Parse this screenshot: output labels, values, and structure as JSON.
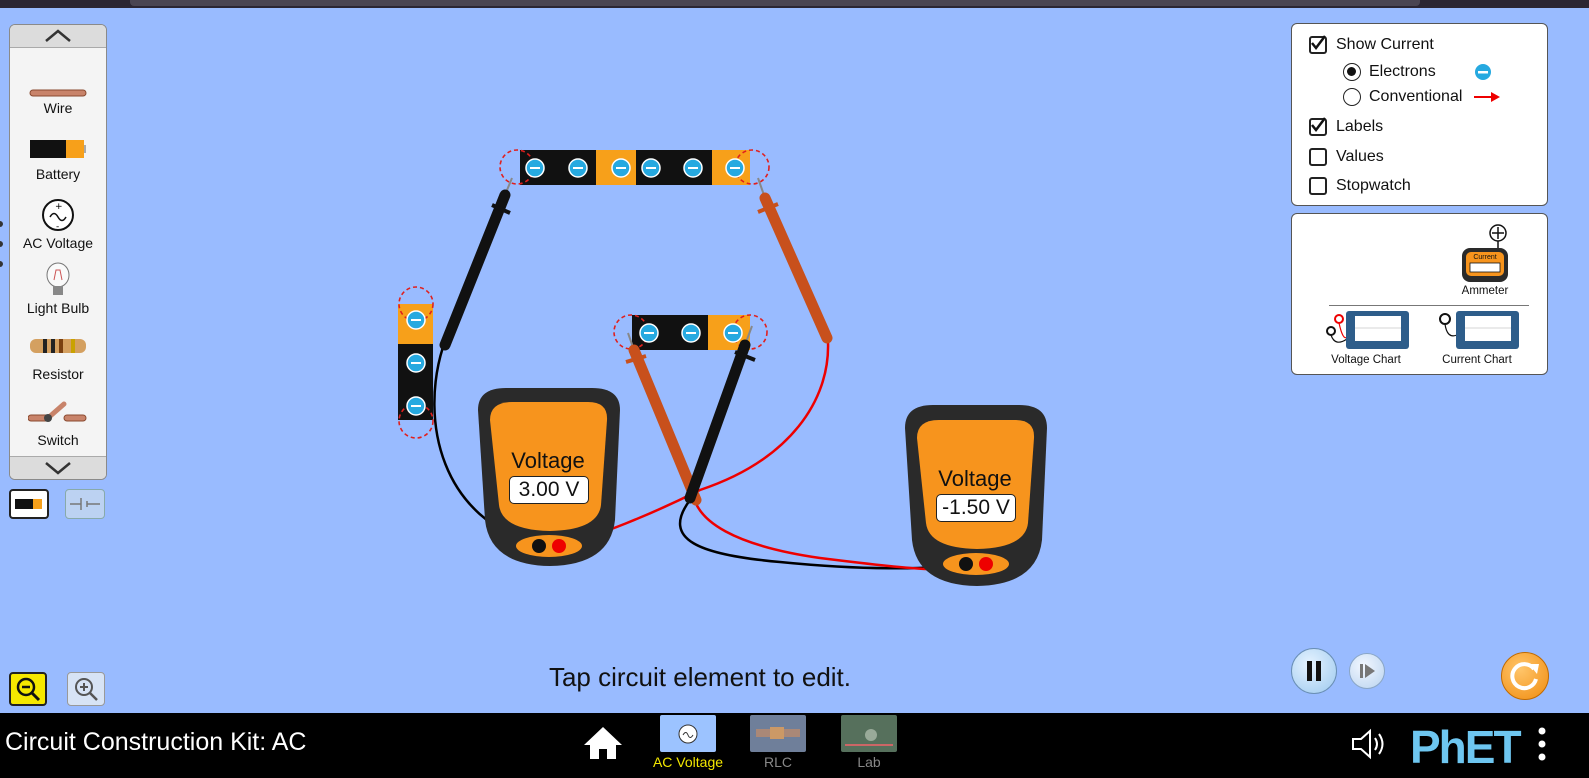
{
  "app": {
    "title": "Circuit Construction Kit: AC",
    "brand": "PhET"
  },
  "toolbox": {
    "items": [
      {
        "label": "Wire",
        "icon": "wire-icon"
      },
      {
        "label": "Battery",
        "icon": "battery-icon"
      },
      {
        "label": "AC Voltage",
        "icon": "ac-voltage-icon"
      },
      {
        "label": "Light Bulb",
        "icon": "light-bulb-icon"
      },
      {
        "label": "Resistor",
        "icon": "resistor-icon"
      },
      {
        "label": "Switch",
        "icon": "switch-icon"
      }
    ]
  },
  "controls": {
    "show_current": {
      "label": "Show Current",
      "checked": true
    },
    "electrons": {
      "label": "Electrons",
      "selected": true
    },
    "conventional": {
      "label": "Conventional",
      "selected": false
    },
    "labels": {
      "label": "Labels",
      "checked": true
    },
    "values": {
      "label": "Values",
      "checked": false
    },
    "stopwatch": {
      "label": "Stopwatch",
      "checked": false
    }
  },
  "sensors": {
    "ammeter": {
      "label": "Ammeter",
      "face_text": "Current"
    },
    "voltage_chart": {
      "label": "Voltage Chart"
    },
    "current_chart": {
      "label": "Current Chart"
    }
  },
  "voltmeters": [
    {
      "label": "Voltage",
      "reading": "3.00 V"
    },
    {
      "label": "Voltage",
      "reading": "-1.50 V"
    }
  ],
  "hint": "Tap circuit element to edit.",
  "nav": {
    "screens": [
      {
        "label": "AC Voltage",
        "selected": true
      },
      {
        "label": "RLC",
        "selected": false
      },
      {
        "label": "Lab",
        "selected": false
      }
    ]
  },
  "colors": {
    "background": "#99bbff",
    "selected_screen": "#f4e800",
    "meter_orange": "#f7941d",
    "electron": "#26a9e0",
    "zoom_highlight": "#f6e800"
  }
}
